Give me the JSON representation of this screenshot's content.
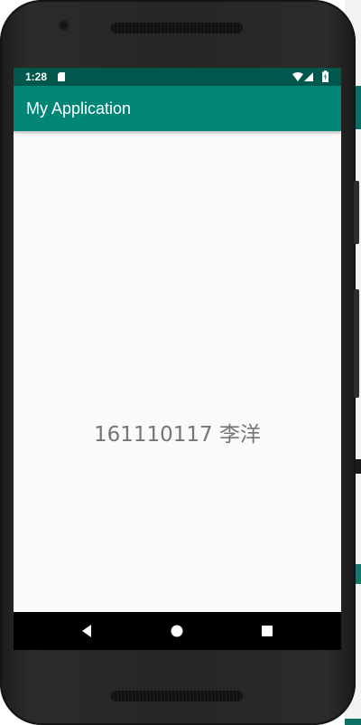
{
  "status_bar": {
    "time": "1:28",
    "icons": [
      "sd-card-icon",
      "wifi-icon",
      "signal-icon",
      "battery-icon"
    ]
  },
  "app_bar": {
    "title": "My Application"
  },
  "content": {
    "text": "161110117 李洋"
  },
  "nav_bar": {
    "icons": [
      "back-icon",
      "home-icon",
      "recents-icon"
    ]
  },
  "colors": {
    "status_bar": "#00574b",
    "app_bar": "#008577",
    "screen_bg": "#fafafa",
    "text": "#757575"
  }
}
